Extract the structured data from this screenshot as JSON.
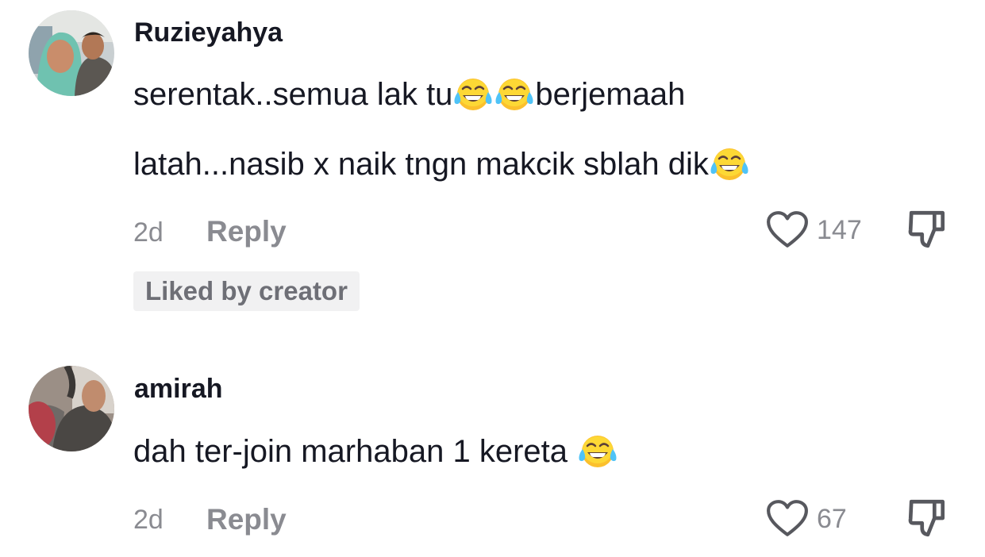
{
  "comments": [
    {
      "username": "Ruzieyahya",
      "line1_part1": "serentak..semua lak tu",
      "line1_part2": "berjemaah",
      "line2": "latah...nasib x naik tngn makcik sblah dik",
      "time": "2d",
      "reply_label": "Reply",
      "likes": "147",
      "badge": "Liked by creator",
      "emoji": "face-with-tears-of-joy"
    },
    {
      "username": "amirah",
      "line1_part1": "dah ter-join marhaban 1 kereta",
      "time": "2d",
      "reply_label": "Reply",
      "likes": "67",
      "emoji": "face-with-tears-of-joy"
    }
  ],
  "colors": {
    "text": "#161823",
    "muted": "#8a8b91",
    "badge_bg": "#f1f1f2"
  }
}
